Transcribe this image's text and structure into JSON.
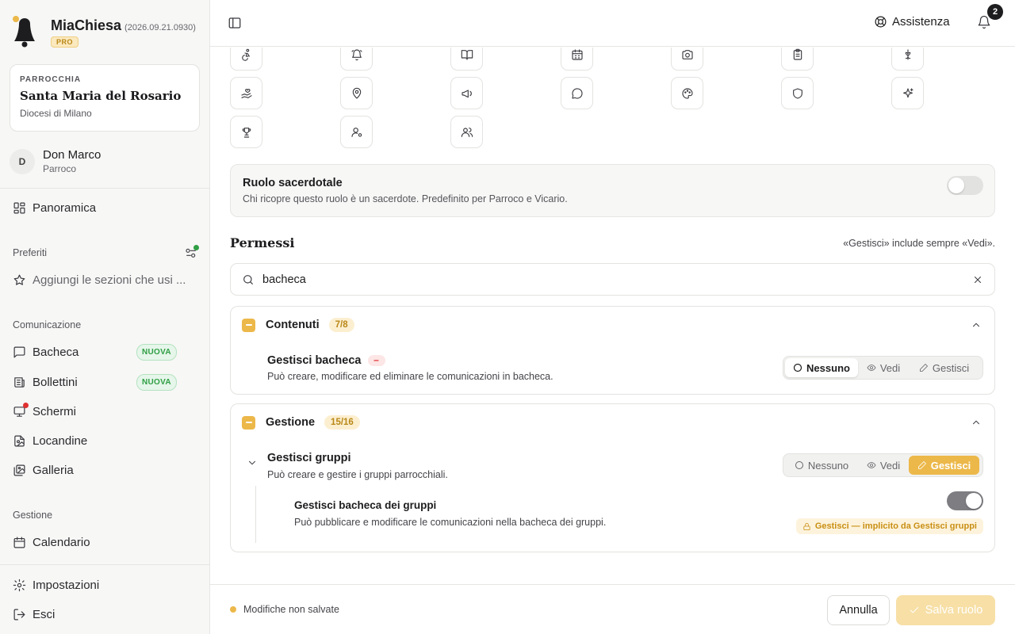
{
  "brand": {
    "name": "MiaChiesa",
    "version": "(2026.09.21.0930)",
    "plan": "PRO"
  },
  "parish": {
    "kicker": "PARROCCHIA",
    "name": "Santa Maria del Rosario",
    "diocese": "Diocesi di Milano"
  },
  "user": {
    "initial": "D",
    "name": "Don Marco",
    "role": "Parroco"
  },
  "sidebar": {
    "overview": "Panoramica",
    "favorites_title": "Preferiti",
    "favorites_add": "Aggiungi le sezioni che usi ...",
    "communication_title": "Comunicazione",
    "communication": [
      {
        "label": "Bacheca",
        "badge": "NUOVA",
        "icon": "message-square-icon"
      },
      {
        "label": "Bollettini",
        "badge": "NUOVA",
        "icon": "newspaper-icon"
      },
      {
        "label": "Schermi",
        "badge": "",
        "icon": "monitor-icon"
      },
      {
        "label": "Locandine",
        "badge": "",
        "icon": "file-image-icon"
      },
      {
        "label": "Galleria",
        "badge": "",
        "icon": "images-icon"
      }
    ],
    "management_title": "Gestione",
    "management": [
      {
        "label": "Calendario",
        "icon": "calendar-icon"
      }
    ],
    "settings": "Impostazioni",
    "logout": "Esci"
  },
  "header": {
    "help": "Assistenza",
    "notifications_count": "2"
  },
  "icon_picker": [
    "accessibility-icon",
    "bell-ring-icon",
    "book-open-icon",
    "calendar-icon",
    "camera-icon",
    "clipboard-icon",
    "flower-icon",
    "hand-heart-icon",
    "map-pin-icon",
    "megaphone-icon",
    "message-circle-icon",
    "palette-icon",
    "shield-icon",
    "sparkles-icon",
    "trophy-icon",
    "user-cog-icon",
    "users-icon"
  ],
  "priest_role": {
    "title": "Ruolo sacerdotale",
    "description": "Chi ricopre questo ruolo è un sacerdote. Predefinito per Parroco e Vicario.",
    "enabled": false
  },
  "permissions": {
    "title": "Permessi",
    "note": "«Gestisci» include sempre «Vedi».",
    "search_value": "bacheca",
    "options": {
      "none": "Nessuno",
      "view": "Vedi",
      "manage": "Gestisci"
    },
    "groups": [
      {
        "name": "Contenuti",
        "count": "7/8",
        "items": [
          {
            "title": "Gestisci bacheca",
            "description": "Può creare, modificare ed eliminare le comunicazioni in bacheca.",
            "level": "none",
            "changed_marker": "–"
          }
        ]
      },
      {
        "name": "Gestione",
        "count": "15/16",
        "items": [
          {
            "title": "Gestisci gruppi",
            "description": "Può creare e gestire i gruppi parrocchiali.",
            "level": "manage",
            "sub": {
              "title": "Gestisci bacheca dei gruppi",
              "description": "Può pubblicare e modificare le comunicazioni nella bacheca dei gruppi.",
              "enabled": true,
              "implicit_note": "Gestisci — implicito da Gestisci gruppi"
            }
          }
        ]
      }
    ]
  },
  "footer": {
    "unsaved": "Modifiche non salvate",
    "cancel": "Annulla",
    "save": "Salva ruolo"
  },
  "colors": {
    "accent": "#ecb84a",
    "accent_soft": "#f7dfa6",
    "new_badge": "#2f9e44",
    "alert": "#e03131"
  }
}
